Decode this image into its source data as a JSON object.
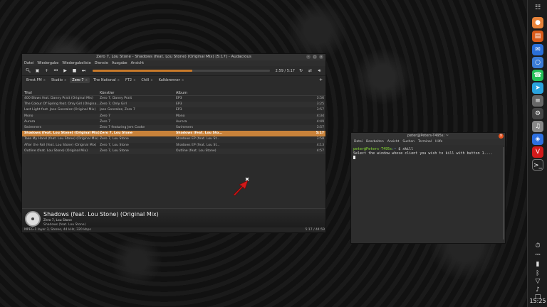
{
  "player": {
    "title": "Zero 7, Lou Stone - Shadows (feat. Lou Stone) (Original Mix) [5:17] - Audacious",
    "menu": [
      "Datei",
      "Wiedergabe",
      "Wiedergabeliste",
      "Dienste",
      "Ausgabe",
      "Ansicht"
    ],
    "time": "2:59 / 5:17",
    "progress": 0.565,
    "tabs": [
      {
        "label": "Ernst.FM",
        "active": false
      },
      {
        "label": "Studio",
        "active": false
      },
      {
        "label": "Zero 7",
        "active": true
      },
      {
        "label": "The National",
        "active": false
      },
      {
        "label": "FT2",
        "active": false
      },
      {
        "label": "Chill",
        "active": false
      },
      {
        "label": "Kalkbrenner",
        "active": false
      }
    ],
    "columns": {
      "title": "Titel",
      "artist": "Künstler",
      "album": "Album",
      "length": ""
    },
    "tracks": [
      {
        "title": "400 Blows feat. Danny Pratt (Original Mix)",
        "artist": "Zero 7, Danny Pratt",
        "album": "EP3",
        "length": "3:56",
        "selected": false
      },
      {
        "title": "The Colour Of Spring feat. Only Girl (Original Mix)",
        "artist": "Zero 7, Only Girl",
        "album": "EP3",
        "length": "3:25",
        "selected": false
      },
      {
        "title": "Last Light feat. Jose Gonzalez (Original Mix)",
        "artist": "Jose Gonzalez, Zero 7",
        "album": "EP3",
        "length": "3:57",
        "selected": false
      },
      {
        "title": "Mono",
        "artist": "Zero 7",
        "album": "Mono",
        "length": "4:34",
        "selected": false
      },
      {
        "title": "Aurora",
        "artist": "Zero 7",
        "album": "Aurora",
        "length": "4:49",
        "selected": false
      },
      {
        "title": "Swimmers",
        "artist": "Zero 7 featuring Jem Cooke",
        "album": "Swimmers",
        "length": "3:57",
        "selected": false
      },
      {
        "title": "Shadows (feat. Lou Stone) (Original Mix)",
        "artist": "Zero 7, Lou Stone",
        "album": "Shadows (feat. Lou Sto...",
        "length": "5:17",
        "selected": true
      },
      {
        "title": "Take My Hand (feat. Lou Stone) (Original Mix)",
        "artist": "Zero 7, Lou Stone",
        "album": "Shadows EP (feat. Lou St...",
        "length": "3:58",
        "selected": false
      },
      {
        "title": "After the Fall (feat. Lou Stone) (Original Mix)",
        "artist": "Zero 7, Lou Stone",
        "album": "Shadows EP (feat. Lou St...",
        "length": "4:13",
        "selected": false
      },
      {
        "title": "Outline (feat. Lou Stone) (Original Mix)",
        "artist": "Zero 7, Lou Stone",
        "album": "Outline (feat. Lou Stone)",
        "length": "4:57",
        "selected": false
      }
    ],
    "now_playing": {
      "title": "Shadows (feat. Lou Stone) (Original Mix)",
      "artist": "Zero 7, Lou Stone",
      "album": "Shadows (feat. Lou Stone)"
    },
    "status_left": "MPEG-1 layer 3, Stereo, 44 kHz, 320 kbps",
    "status_right": "5:17 / 44:59"
  },
  "terminal": {
    "title": "peter@Peters-T495s: ~",
    "menu": [
      "Datei",
      "Bearbeiten",
      "Ansicht",
      "Suchen",
      "Terminal",
      "Hilfe"
    ],
    "prompt_user": "peter@Peters-T495s",
    "prompt_path": ":~",
    "command": "$ xkill",
    "output": "Select the window whose client you wish to kill with button 1...."
  },
  "clock": "15:25",
  "accent": "#c8823a"
}
